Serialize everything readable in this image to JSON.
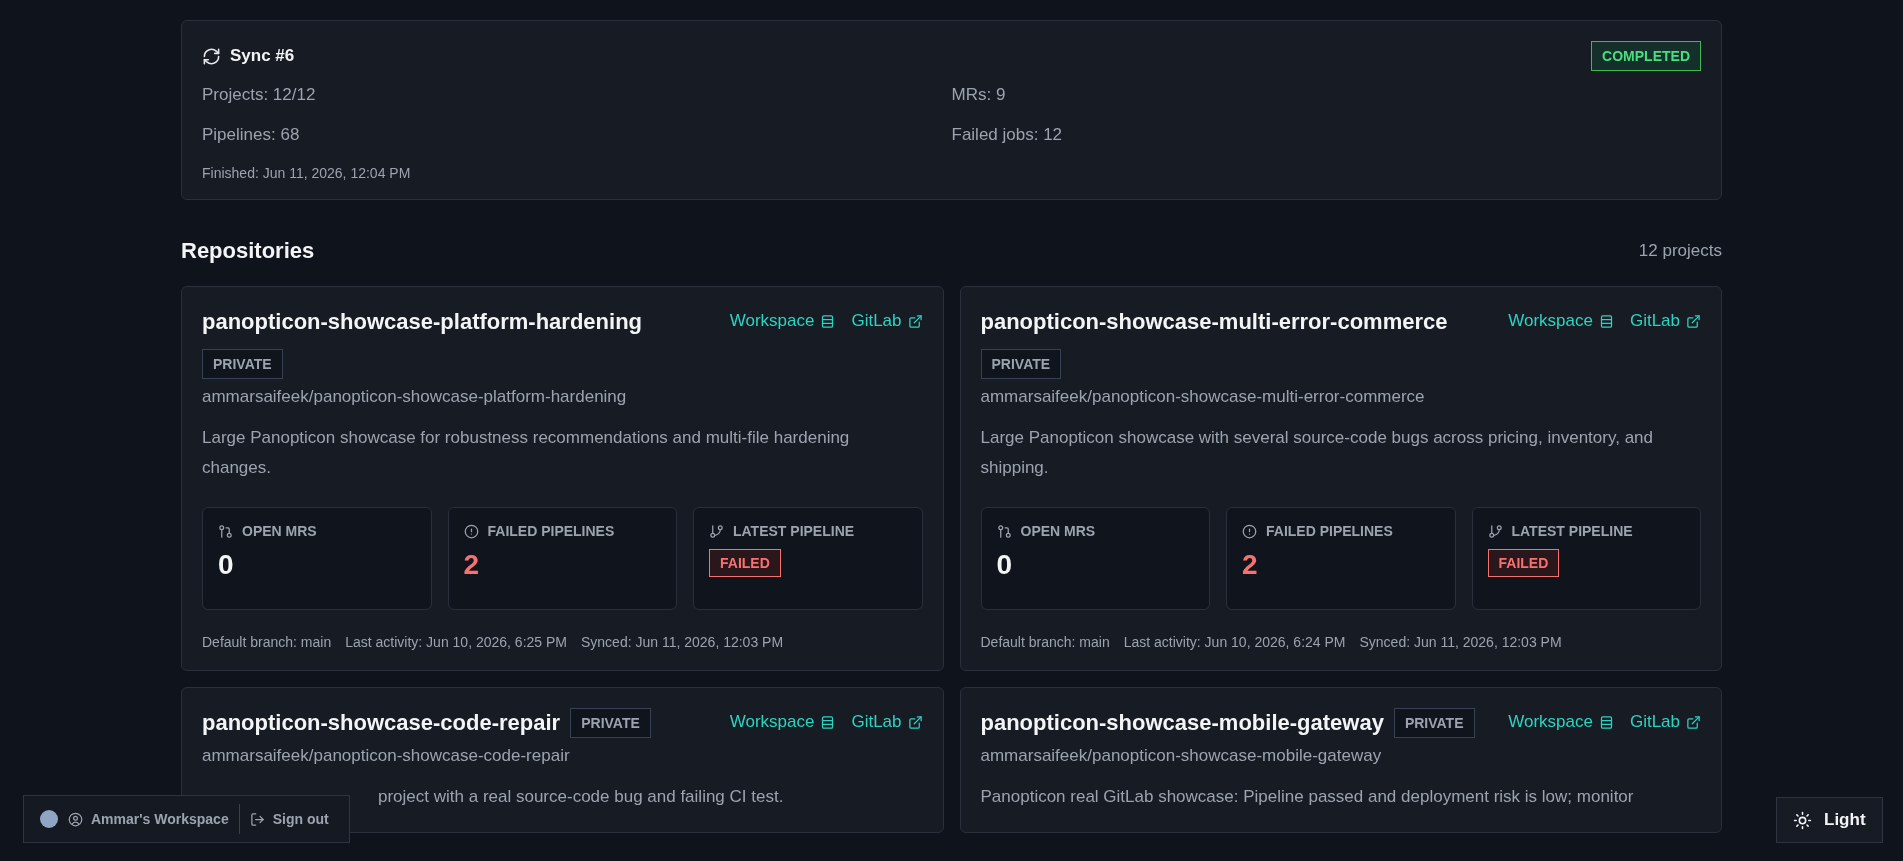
{
  "sync": {
    "title": "Sync #6",
    "status": "COMPLETED",
    "status_ok": true,
    "stats": [
      "Projects: 12/12",
      "MRs: 9",
      "Pipelines: 68",
      "Failed jobs: 12"
    ],
    "finished": "Finished: Jun 11, 2026, 12:04 PM"
  },
  "repositories": {
    "heading": "Repositories",
    "count": "12 projects",
    "items": [
      {
        "name": "panopticon-showcase-platform-hardening",
        "visibility": "PRIVATE",
        "path": "ammarsaifeek/panopticon-showcase-platform-hardening",
        "description": "Large Panopticon showcase for robustness recommendations and multi-file hardening changes.",
        "workspace_link": "Workspace",
        "gitlab_link": "GitLab",
        "stats": [
          {
            "kind": "number",
            "label": "OPEN MRS",
            "value": "0",
            "alert": false
          },
          {
            "kind": "number",
            "label": "FAILED PIPELINES",
            "value": "2",
            "alert": true
          },
          {
            "kind": "status",
            "label": "LATEST PIPELINE",
            "value": "FAILED",
            "alert": true
          }
        ],
        "footer": [
          "Default branch: main",
          "Last activity: Jun 10, 2026, 6:25 PM",
          "Synced: Jun 11, 2026, 12:03 PM"
        ]
      },
      {
        "name": "panopticon-showcase-multi-error-commerce",
        "visibility": "PRIVATE",
        "path": "ammarsaifeek/panopticon-showcase-multi-error-commerce",
        "description": "Large Panopticon showcase with several source-code bugs across pricing, inventory, and shipping.",
        "workspace_link": "Workspace",
        "gitlab_link": "GitLab",
        "stats": [
          {
            "kind": "number",
            "label": "OPEN MRS",
            "value": "0",
            "alert": false
          },
          {
            "kind": "number",
            "label": "FAILED PIPELINES",
            "value": "2",
            "alert": true
          },
          {
            "kind": "status",
            "label": "LATEST PIPELINE",
            "value": "FAILED",
            "alert": true
          }
        ],
        "footer": [
          "Default branch: main",
          "Last activity: Jun 10, 2026, 6:24 PM",
          "Synced: Jun 11, 2026, 12:03 PM"
        ]
      },
      {
        "name": "panopticon-showcase-code-repair",
        "visibility": "PRIVATE",
        "path": "ammarsaifeek/panopticon-showcase-code-repair",
        "description": "project with a real source-code bug and failing CI test.",
        "description_covered": true,
        "workspace_link": "Workspace",
        "gitlab_link": "GitLab"
      },
      {
        "name": "panopticon-showcase-mobile-gateway",
        "visibility": "PRIVATE",
        "path": "ammarsaifeek/panopticon-showcase-mobile-gateway",
        "description": "Panopticon real GitLab showcase: Pipeline passed and deployment risk is low; monitor",
        "description_covered": false,
        "workspace_link": "Workspace",
        "gitlab_link": "GitLab"
      }
    ]
  },
  "account_bar": {
    "workspace": "Ammar's Workspace",
    "sign_out": "Sign out"
  },
  "theme_toggle": {
    "label": "Light"
  }
}
